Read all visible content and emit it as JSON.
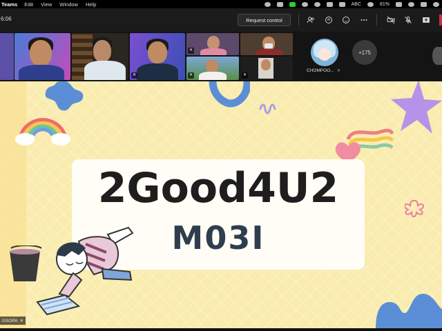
{
  "menubar": {
    "app": "Teams",
    "menus": [
      "Edit",
      "View",
      "Window",
      "Help"
    ],
    "status_text": "ABC",
    "battery": "81%"
  },
  "toolbar": {
    "timer": "6:06",
    "request_control_label": "Request control"
  },
  "participants": {
    "avatar_name": "CHOMPOO...",
    "more_count": "+175"
  },
  "slide": {
    "title": "2Good4U2",
    "subtitle": "M03I",
    "presenter_label": "GSOPA"
  },
  "colors": {
    "slide_bg": "#f9ecae",
    "card_bg": "#fffdf6",
    "leave_red": "#c4314b"
  }
}
